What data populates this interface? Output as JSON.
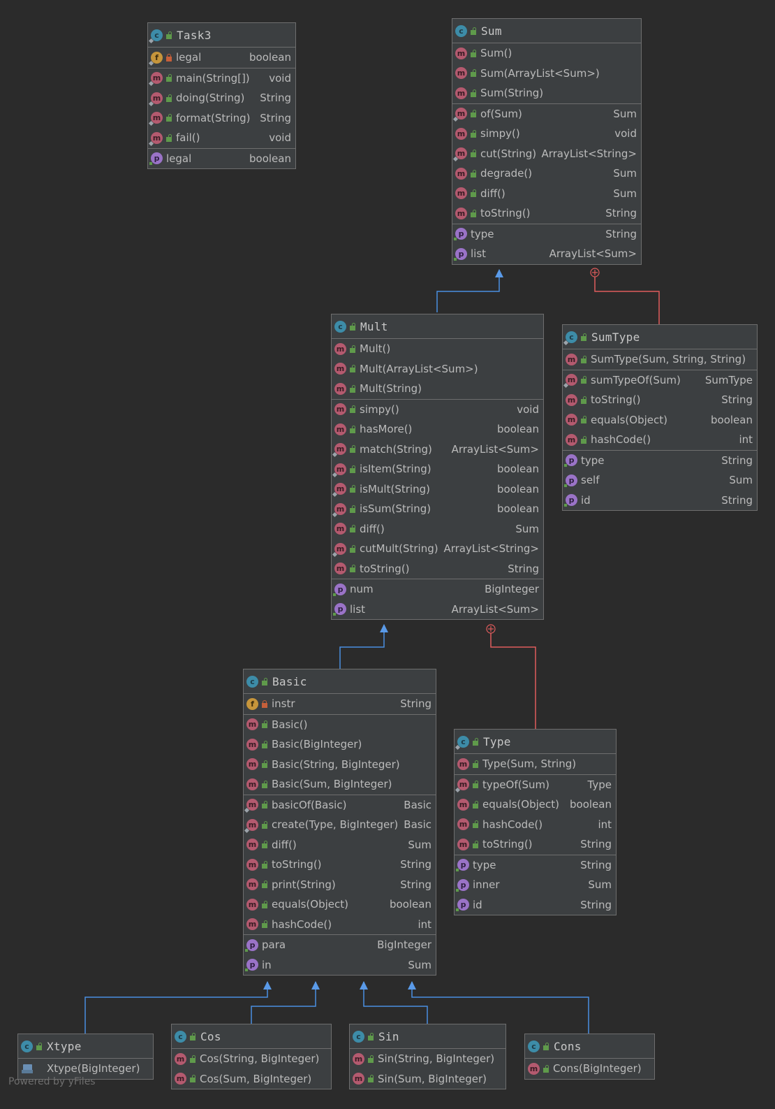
{
  "classes": {
    "task3": {
      "name": "Task3",
      "fields": [
        {
          "name": "legal",
          "type": "boolean"
        }
      ],
      "methods": [
        {
          "name": "main(String[])",
          "type": "void"
        },
        {
          "name": "doing(String)",
          "type": "String"
        },
        {
          "name": "format(String)",
          "type": "String"
        },
        {
          "name": "fail()",
          "type": "void"
        }
      ],
      "properties": [
        {
          "name": "legal",
          "type": "boolean"
        }
      ]
    },
    "sum": {
      "name": "Sum",
      "constructors": [
        {
          "name": "Sum()"
        },
        {
          "name": "Sum(ArrayList<Sum>)"
        },
        {
          "name": "Sum(String)"
        }
      ],
      "methods": [
        {
          "name": "of(Sum)",
          "type": "Sum"
        },
        {
          "name": "simpy()",
          "type": "void"
        },
        {
          "name": "cut(String)",
          "type": "ArrayList<String>"
        },
        {
          "name": "degrade()",
          "type": "Sum"
        },
        {
          "name": "diff()",
          "type": "Sum"
        },
        {
          "name": "toString()",
          "type": "String"
        }
      ],
      "properties": [
        {
          "name": "type",
          "type": "String"
        },
        {
          "name": "list",
          "type": "ArrayList<Sum>"
        }
      ]
    },
    "mult": {
      "name": "Mult",
      "constructors": [
        {
          "name": "Mult()"
        },
        {
          "name": "Mult(ArrayList<Sum>)"
        },
        {
          "name": "Mult(String)"
        }
      ],
      "methods": [
        {
          "name": "simpy()",
          "type": "void"
        },
        {
          "name": "hasMore()",
          "type": "boolean"
        },
        {
          "name": "match(String)",
          "type": "ArrayList<Sum>"
        },
        {
          "name": "isItem(String)",
          "type": "boolean"
        },
        {
          "name": "isMult(String)",
          "type": "boolean"
        },
        {
          "name": "isSum(String)",
          "type": "boolean"
        },
        {
          "name": "diff()",
          "type": "Sum"
        },
        {
          "name": "cutMult(String)",
          "type": "ArrayList<String>"
        },
        {
          "name": "toString()",
          "type": "String"
        }
      ],
      "properties": [
        {
          "name": "num",
          "type": "BigInteger"
        },
        {
          "name": "list",
          "type": "ArrayList<Sum>"
        }
      ]
    },
    "sumtype": {
      "name": "SumType",
      "constructors": [
        {
          "name": "SumType(Sum, String, String)"
        }
      ],
      "methods": [
        {
          "name": "sumTypeOf(Sum)",
          "type": "SumType"
        },
        {
          "name": "toString()",
          "type": "String"
        },
        {
          "name": "equals(Object)",
          "type": "boolean"
        },
        {
          "name": "hashCode()",
          "type": "int"
        }
      ],
      "properties": [
        {
          "name": "type",
          "type": "String"
        },
        {
          "name": "self",
          "type": "Sum"
        },
        {
          "name": "id",
          "type": "String"
        }
      ]
    },
    "basic": {
      "name": "Basic",
      "fields": [
        {
          "name": "instr",
          "type": "String"
        }
      ],
      "constructors": [
        {
          "name": "Basic()"
        },
        {
          "name": "Basic(BigInteger)"
        },
        {
          "name": "Basic(String, BigInteger)"
        },
        {
          "name": "Basic(Sum, BigInteger)"
        }
      ],
      "methods": [
        {
          "name": "basicOf(Basic)",
          "type": "Basic"
        },
        {
          "name": "create(Type, BigInteger)",
          "type": "Basic"
        },
        {
          "name": "diff()",
          "type": "Sum"
        },
        {
          "name": "toString()",
          "type": "String"
        },
        {
          "name": "print(String)",
          "type": "String"
        },
        {
          "name": "equals(Object)",
          "type": "boolean"
        },
        {
          "name": "hashCode()",
          "type": "int"
        }
      ],
      "properties": [
        {
          "name": "para",
          "type": "BigInteger"
        },
        {
          "name": "in",
          "type": "Sum"
        }
      ]
    },
    "type": {
      "name": "Type",
      "constructors": [
        {
          "name": "Type(Sum, String)"
        }
      ],
      "methods": [
        {
          "name": "typeOf(Sum)",
          "type": "Type"
        },
        {
          "name": "equals(Object)",
          "type": "boolean"
        },
        {
          "name": "hashCode()",
          "type": "int"
        },
        {
          "name": "toString()",
          "type": "String"
        }
      ],
      "properties": [
        {
          "name": "type",
          "type": "String"
        },
        {
          "name": "inner",
          "type": "Sum"
        },
        {
          "name": "id",
          "type": "String"
        }
      ]
    },
    "xtype": {
      "name": "Xtype",
      "constructors": [
        {
          "name": "Xtype(BigInteger)"
        }
      ]
    },
    "cos": {
      "name": "Cos",
      "constructors": [
        {
          "name": "Cos(String, BigInteger)"
        },
        {
          "name": "Cos(Sum, BigInteger)"
        }
      ]
    },
    "sin": {
      "name": "Sin",
      "constructors": [
        {
          "name": "Sin(String, BigInteger)"
        },
        {
          "name": "Sin(Sum, BigInteger)"
        }
      ]
    },
    "cons": {
      "name": "Cons",
      "constructors": [
        {
          "name": "Cons(BigInteger)"
        }
      ]
    }
  },
  "footer": "Powered by yFiles",
  "colors": {
    "inheritance": "#4a90e2",
    "inner_class": "#e05c5c",
    "background": "#2b2b2b",
    "node": "#3c3f41"
  }
}
